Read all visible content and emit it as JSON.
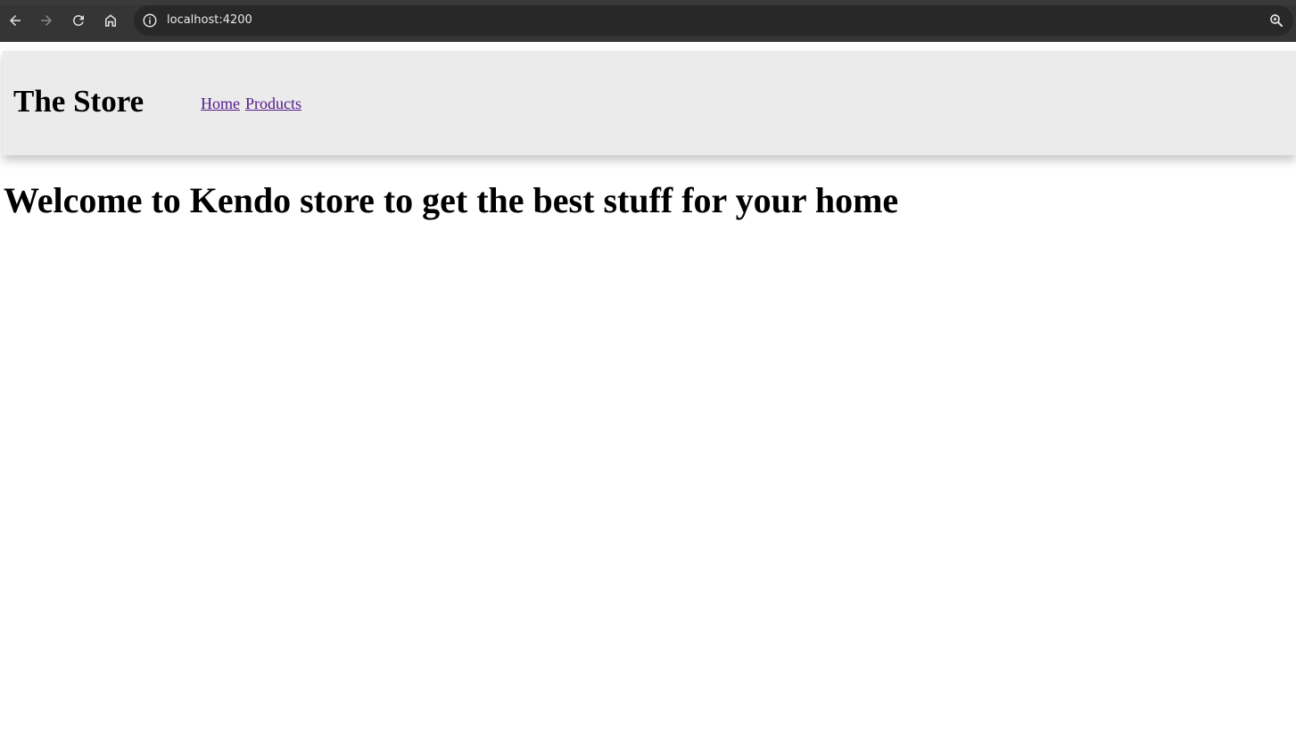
{
  "browser": {
    "url": "localhost:4200",
    "icons": {
      "back": "back-arrow-icon",
      "forward": "forward-arrow-icon",
      "reload": "reload-icon",
      "home": "home-icon",
      "info": "info-icon",
      "zoom": "zoom-icon"
    }
  },
  "header": {
    "title": "The Store",
    "nav": [
      {
        "label": "Home"
      },
      {
        "label": "Products"
      }
    ]
  },
  "main": {
    "heading": "Welcome to Kendo store to get the best stuff for your home"
  },
  "colors": {
    "link": "#551a8b",
    "header_bg": "#ebebeb",
    "chrome_bg": "#353535"
  }
}
